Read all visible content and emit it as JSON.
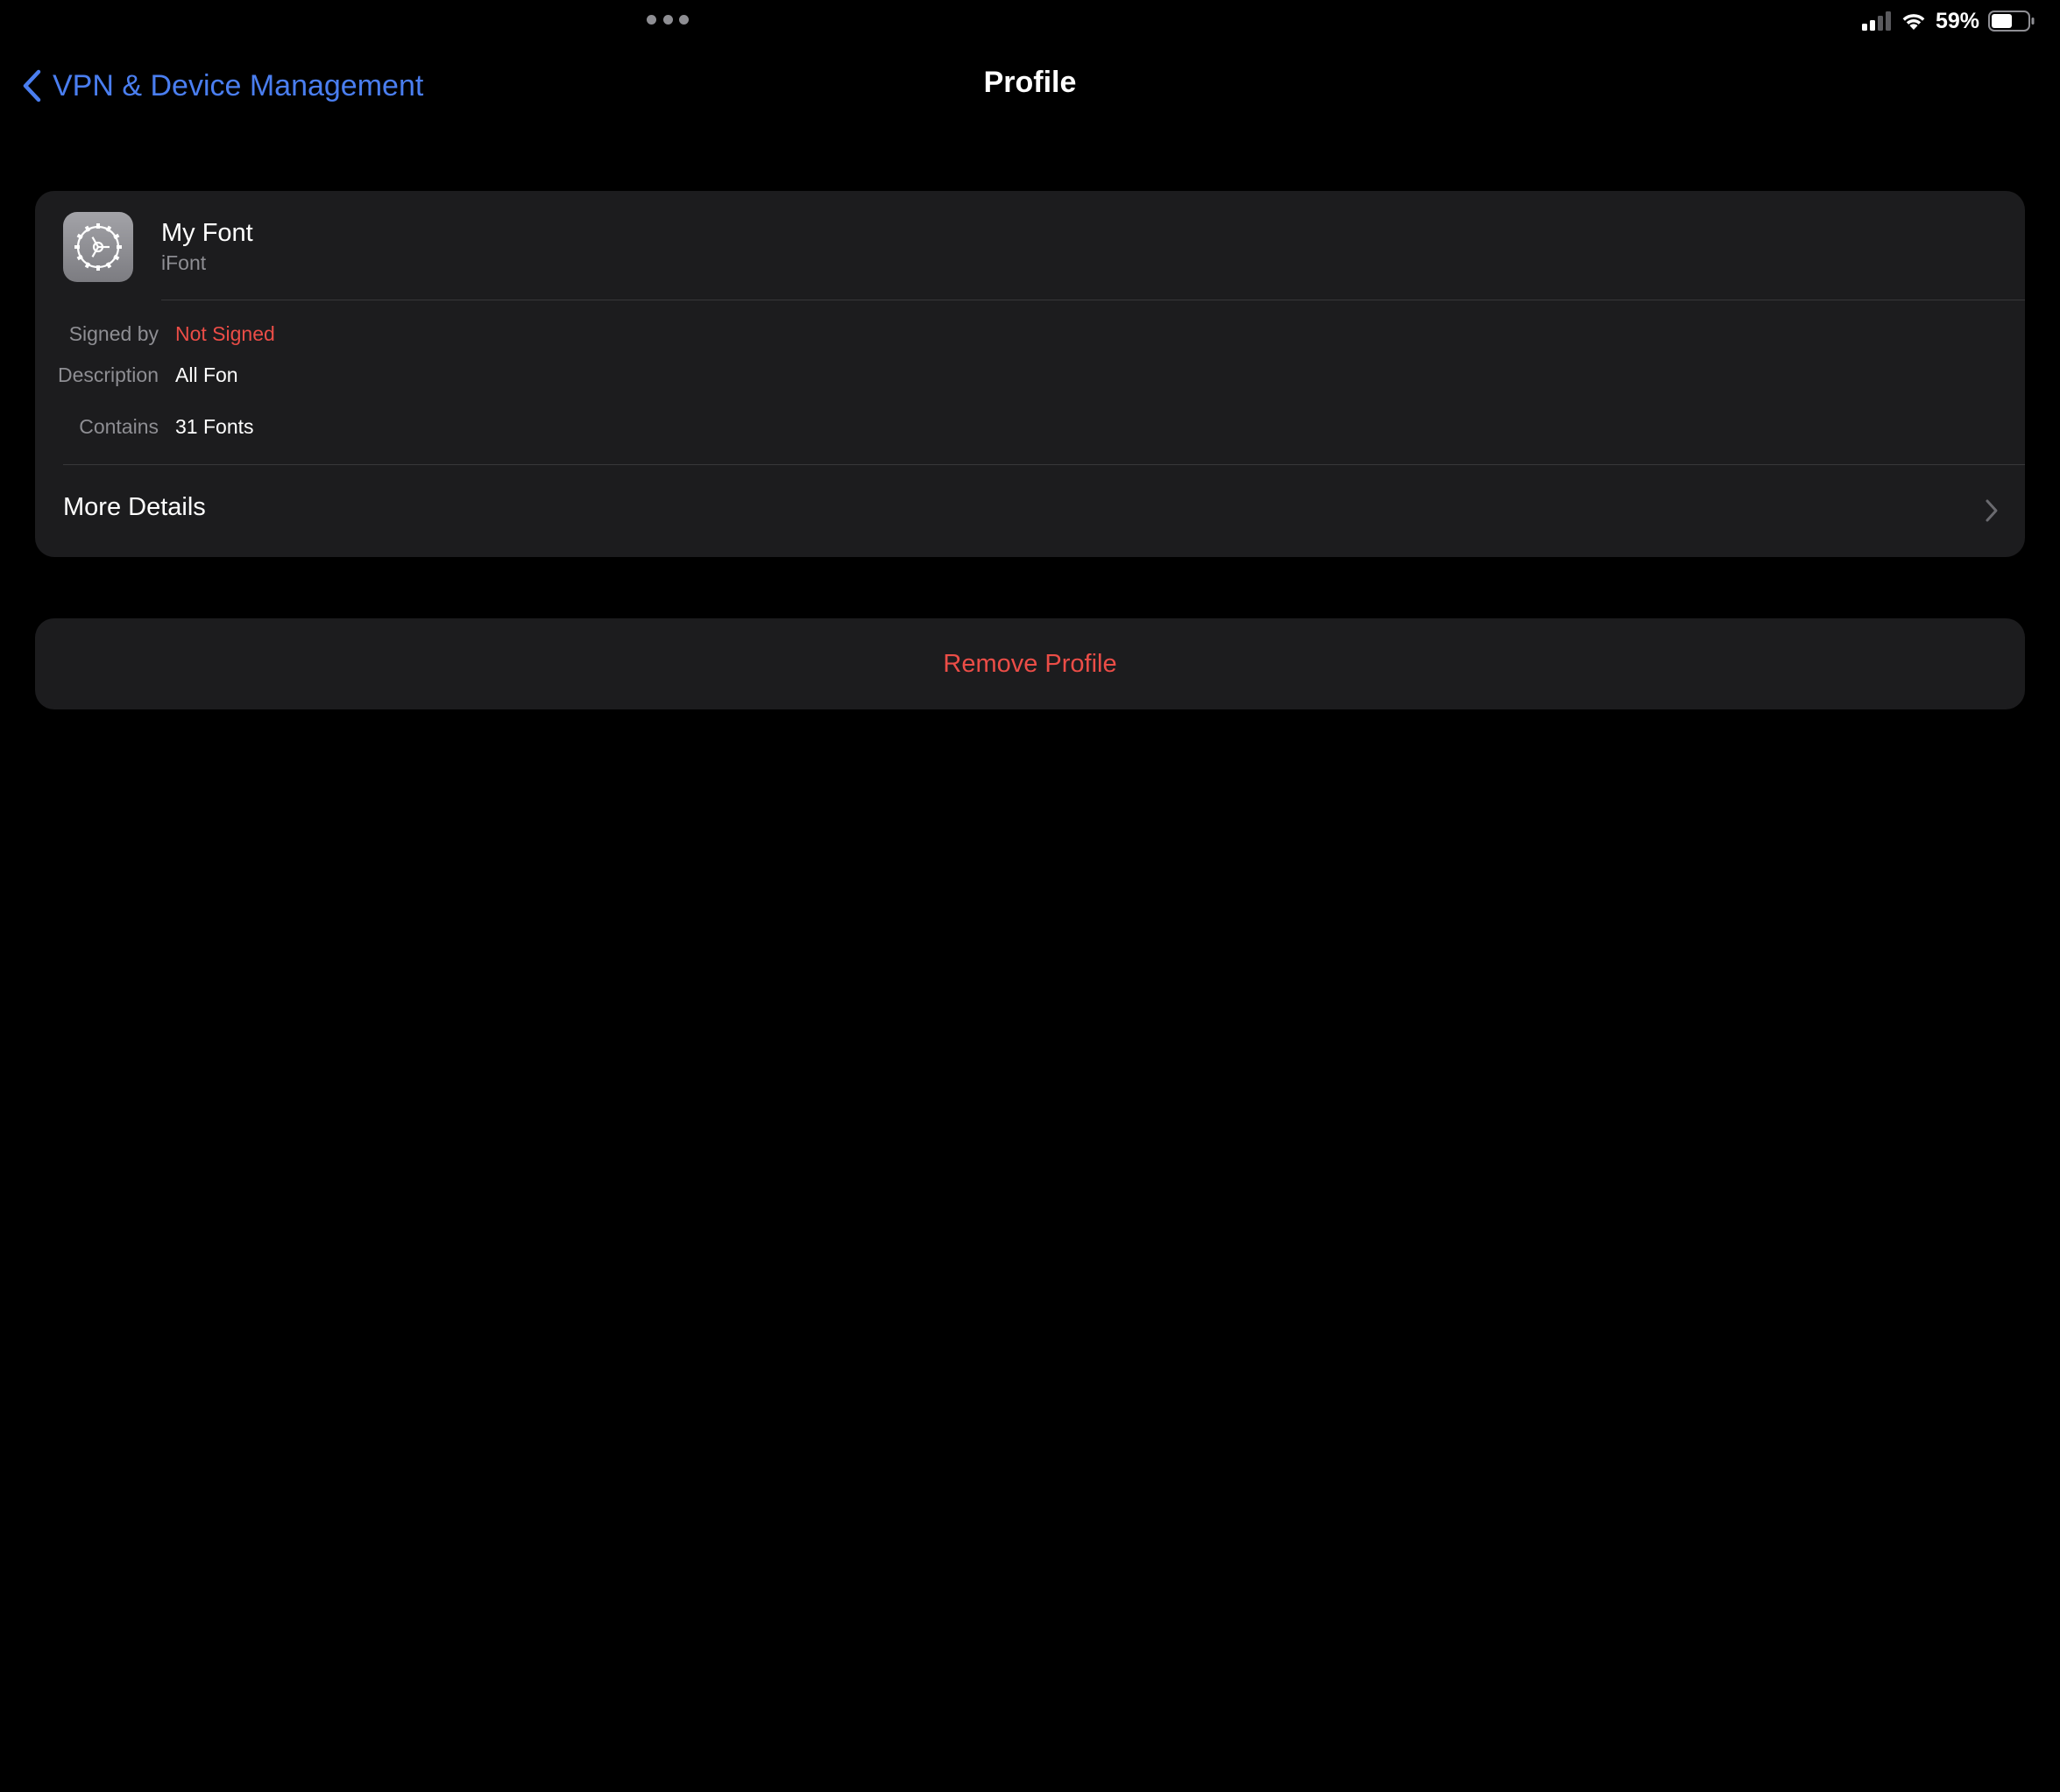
{
  "status_bar": {
    "battery_percent": "59%"
  },
  "nav": {
    "back_label": "VPN & Device Management",
    "title": "Profile"
  },
  "profile": {
    "name": "My Font",
    "organization": "iFont",
    "icon": "settings-gear-icon",
    "details": [
      {
        "label": "Signed by",
        "value": "Not Signed",
        "value_color": "#eb4d47"
      },
      {
        "label": "Description",
        "value": "All Fon"
      },
      {
        "label": "Contains",
        "value": "31 Fonts"
      }
    ],
    "more_details_label": "More Details"
  },
  "actions": {
    "remove_label": "Remove Profile"
  },
  "colors": {
    "accent": "#4a7ef0",
    "destructive": "#eb4d47",
    "card_background": "#1c1c1e",
    "page_background": "#000000"
  }
}
